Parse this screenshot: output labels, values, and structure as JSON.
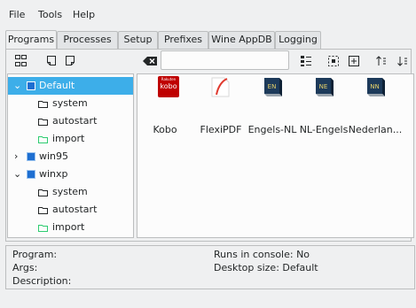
{
  "menu": [
    "File",
    "Tools",
    "Help"
  ],
  "tabs": [
    "Programs",
    "Processes",
    "Setup",
    "Prefixes",
    "Wine AppDB",
    "Logging"
  ],
  "tree": [
    {
      "label": "Default",
      "type": "prefix",
      "expanded": true,
      "selected": true
    },
    {
      "label": "system",
      "type": "folder"
    },
    {
      "label": "autostart",
      "type": "folder"
    },
    {
      "label": "import",
      "type": "folder-import"
    },
    {
      "label": "win95",
      "type": "prefix",
      "expanded": false
    },
    {
      "label": "winxp",
      "type": "prefix",
      "expanded": true
    },
    {
      "label": "system",
      "type": "folder"
    },
    {
      "label": "autostart",
      "type": "folder"
    },
    {
      "label": "import",
      "type": "folder-import"
    }
  ],
  "apps": [
    {
      "label": "Kobo",
      "icon": "kobo-icon",
      "icon_text": "kobo",
      "icon_small": "Rakuten"
    },
    {
      "label": "FlexiPDF",
      "icon": "flexipdf-icon"
    },
    {
      "label": "Engels-NL",
      "icon": "dictionary-icon",
      "icon_text": "EN"
    },
    {
      "label": "NL-Engels",
      "icon": "dictionary-icon",
      "icon_text": "NE"
    },
    {
      "label": "Nederlan...",
      "icon": "dictionary-icon",
      "icon_text": "NN"
    }
  ],
  "info": {
    "program": "Program:",
    "args": "Args:",
    "description": "Description:",
    "runs_in_console": "Runs in console: No",
    "desktop_size": "Desktop size: Default"
  },
  "colors": {
    "selection": "#3daee9",
    "folder_import": "#2ecc71",
    "kobo": "#bf0000",
    "dictionary": "#1d3a5a"
  }
}
